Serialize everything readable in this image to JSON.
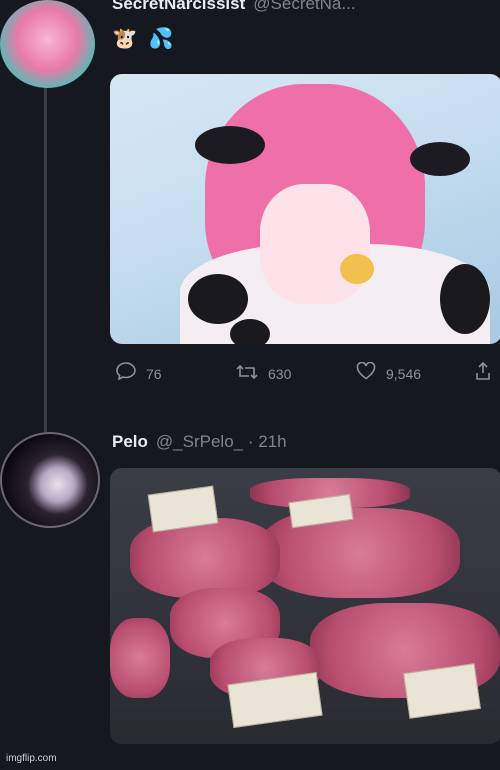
{
  "tweet1": {
    "display_name": "SecretNarcissist",
    "handle": "@SecretNa...",
    "emojis": [
      "🐮",
      "💦"
    ],
    "media_alt": "anime cow girl illustration",
    "actions": {
      "replies": "76",
      "retweets": "630",
      "likes": "9,546"
    }
  },
  "tweet2": {
    "display_name": "Pelo",
    "handle": "@_SrPelo_ · 21h",
    "media_alt": "raw steaks with price tags"
  },
  "watermark": "imgflip.com",
  "icons": {
    "reply": "reply-icon",
    "retweet": "retweet-icon",
    "like": "heart-icon",
    "share": "share-icon"
  }
}
